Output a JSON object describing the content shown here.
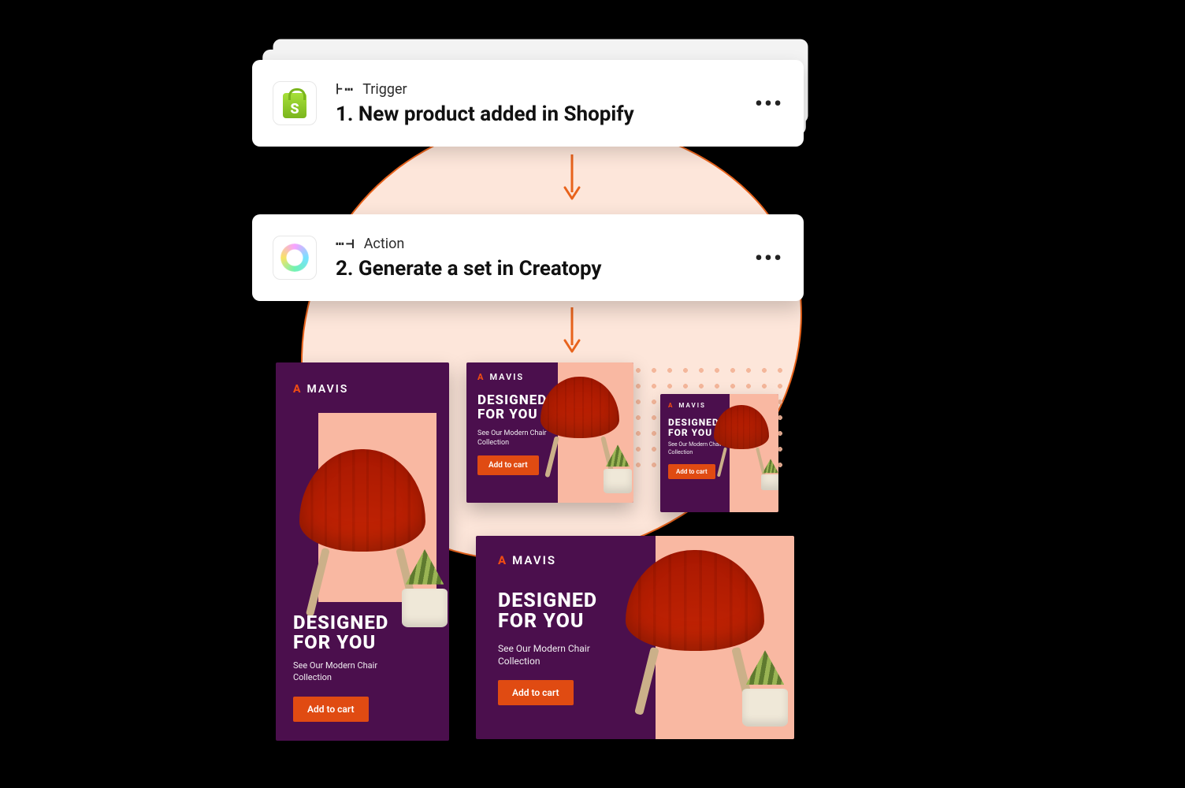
{
  "workflow": {
    "steps": [
      {
        "app": "Shopify",
        "kind_glyph": "⊦⋯",
        "kind_label": "Trigger",
        "title": "1. New product added in Shopify"
      },
      {
        "app": "Creatopy",
        "kind_glyph": "⋯⊣",
        "kind_label": "Action",
        "title": "2. Generate a set in Creatopy"
      }
    ]
  },
  "ad_template": {
    "brand_mark": "A",
    "brand_name": "MAVIS",
    "headline_line1": "DESIGNED",
    "headline_line2": "FOR YOU",
    "subcopy": "See Our Modern Chair Collection",
    "cta": "Add to cart"
  },
  "colors": {
    "accent_orange": "#E8631C",
    "ad_bg": "#4B0F4D",
    "ad_panel": "#F9B8A2",
    "cta": "#E04B12",
    "chair": "#DC5A16",
    "blob_fill": "#FDE6DA"
  }
}
